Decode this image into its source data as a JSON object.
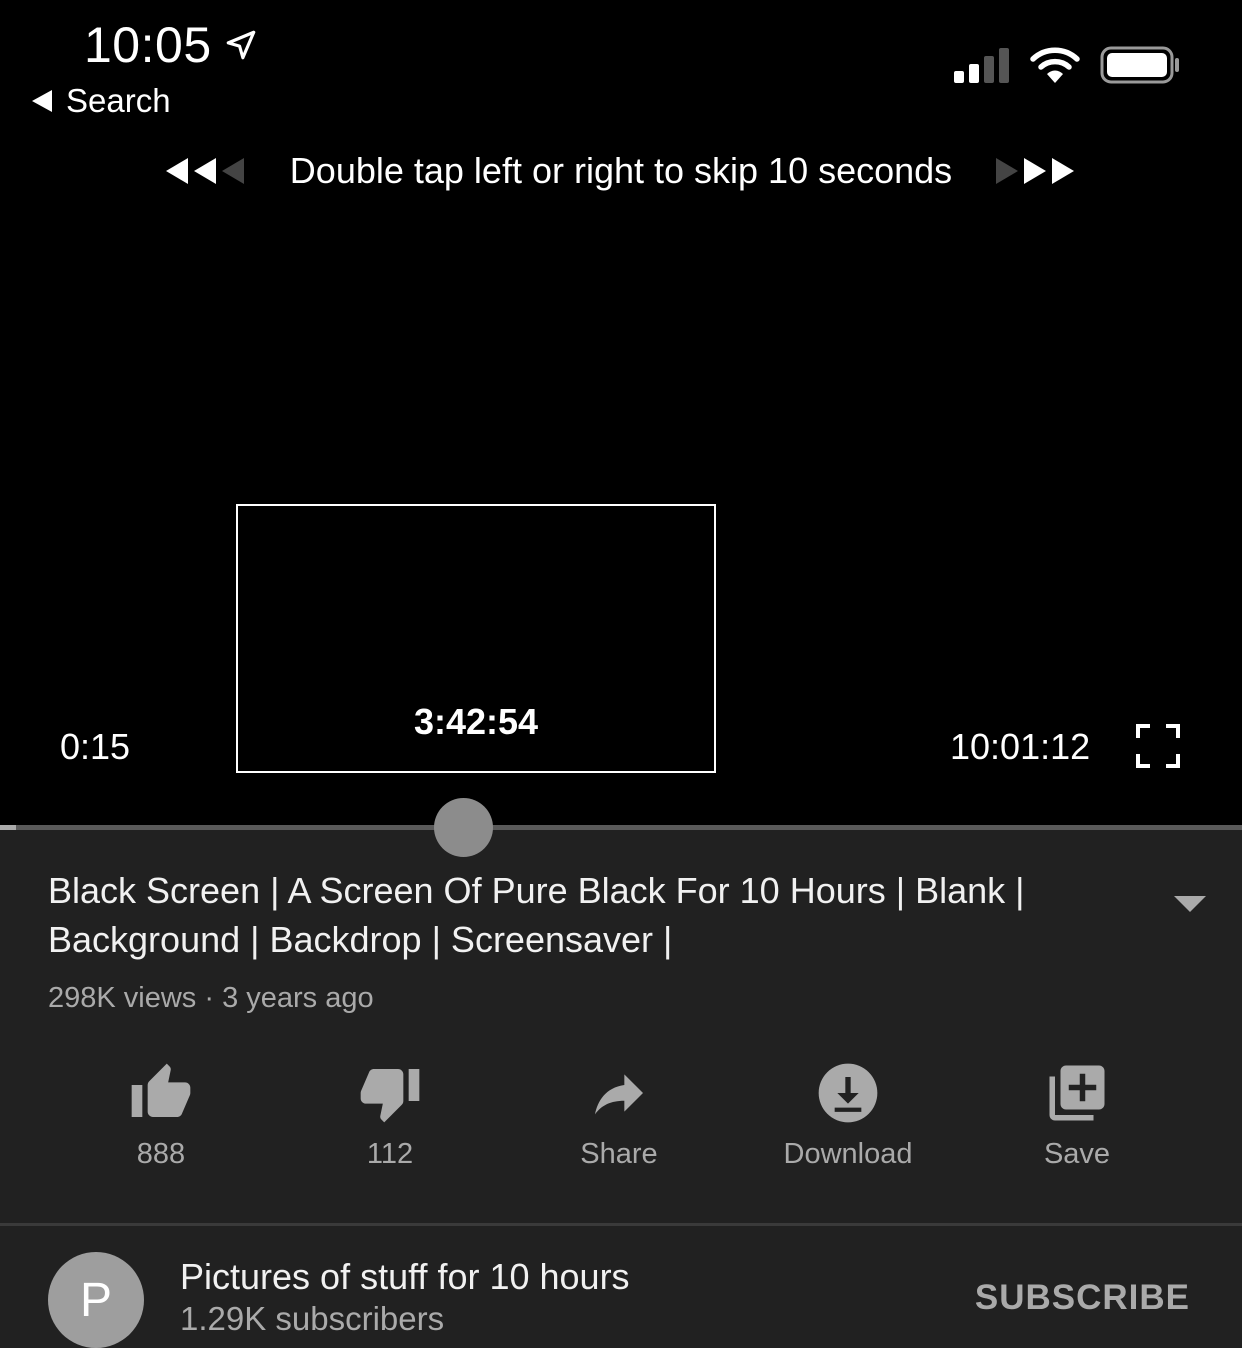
{
  "status_bar": {
    "time": "10:05",
    "location_icon": "location-arrow-icon",
    "signal_icon": "cellular-signal-icon",
    "wifi_icon": "wifi-icon",
    "battery_icon": "battery-icon"
  },
  "nav": {
    "back_label": "Search"
  },
  "player": {
    "skip_hint": "Double tap left or right to skip 10 seconds",
    "current_time": "0:15",
    "duration": "10:01:12",
    "preview_time": "3:42:54",
    "progress_fraction": 0.0025,
    "thumb_fraction": 0.37
  },
  "video": {
    "title": "Black Screen | A Screen Of Pure Black For 10 Hours | Blank | Background | Backdrop | Screensaver |",
    "meta": "298K views · 3 years ago"
  },
  "actions": [
    {
      "icon": "thumbs-up-icon",
      "label": "888"
    },
    {
      "icon": "thumbs-down-icon",
      "label": "112"
    },
    {
      "icon": "share-icon",
      "label": "Share"
    },
    {
      "icon": "download-icon",
      "label": "Download"
    },
    {
      "icon": "save-playlist-icon",
      "label": "Save"
    }
  ],
  "channel": {
    "avatar_letter": "P",
    "name": "Pictures of stuff for 10 hours",
    "subscribers": "1.29K subscribers",
    "subscribe_label": "SUBSCRIBE"
  },
  "colors": {
    "player_bg": "#000000",
    "page_bg": "#212121",
    "muted_text": "#aaaaaa",
    "avatar_bg": "#9e9e9e"
  }
}
